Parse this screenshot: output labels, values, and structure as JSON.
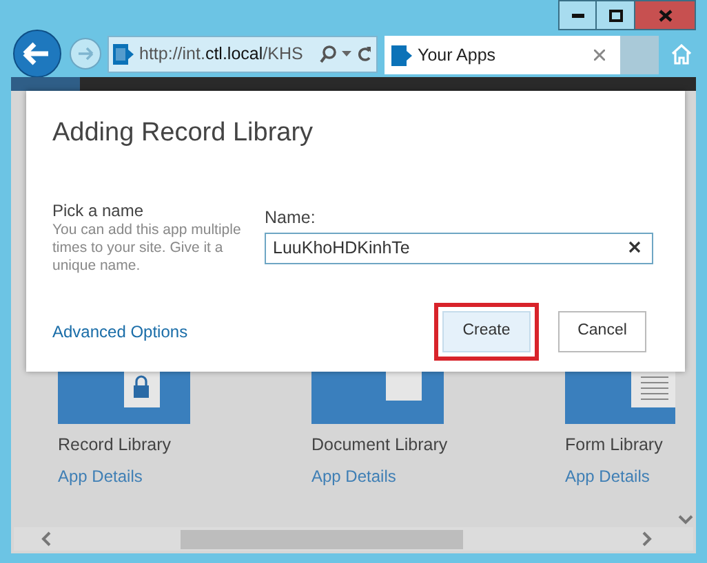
{
  "browser": {
    "address": {
      "parts": [
        {
          "text": "http://int.",
          "kind": "plain"
        },
        {
          "text": "ctl.local",
          "kind": "domain"
        },
        {
          "text": "/KHS",
          "kind": "plain"
        }
      ]
    },
    "tab": {
      "title": "Your Apps"
    }
  },
  "dialog": {
    "title": "Adding Record Library",
    "section_title": "Pick a name",
    "description": "You can add this app multiple times to your site. Give it a unique name.",
    "field": {
      "label": "Name:",
      "value": "LuuKhoHDKinhTe"
    },
    "link": "Advanced Options",
    "buttons": [
      {
        "label": "Create",
        "highlighted": true
      },
      {
        "label": "Cancel",
        "highlighted": false
      }
    ]
  },
  "apps": [
    {
      "name": "Record Library",
      "link": "App Details",
      "kind": "record"
    },
    {
      "name": "Document Library",
      "link": "App Details",
      "kind": "document"
    },
    {
      "name": "Form Library",
      "link": "App Details",
      "kind": "form"
    }
  ]
}
